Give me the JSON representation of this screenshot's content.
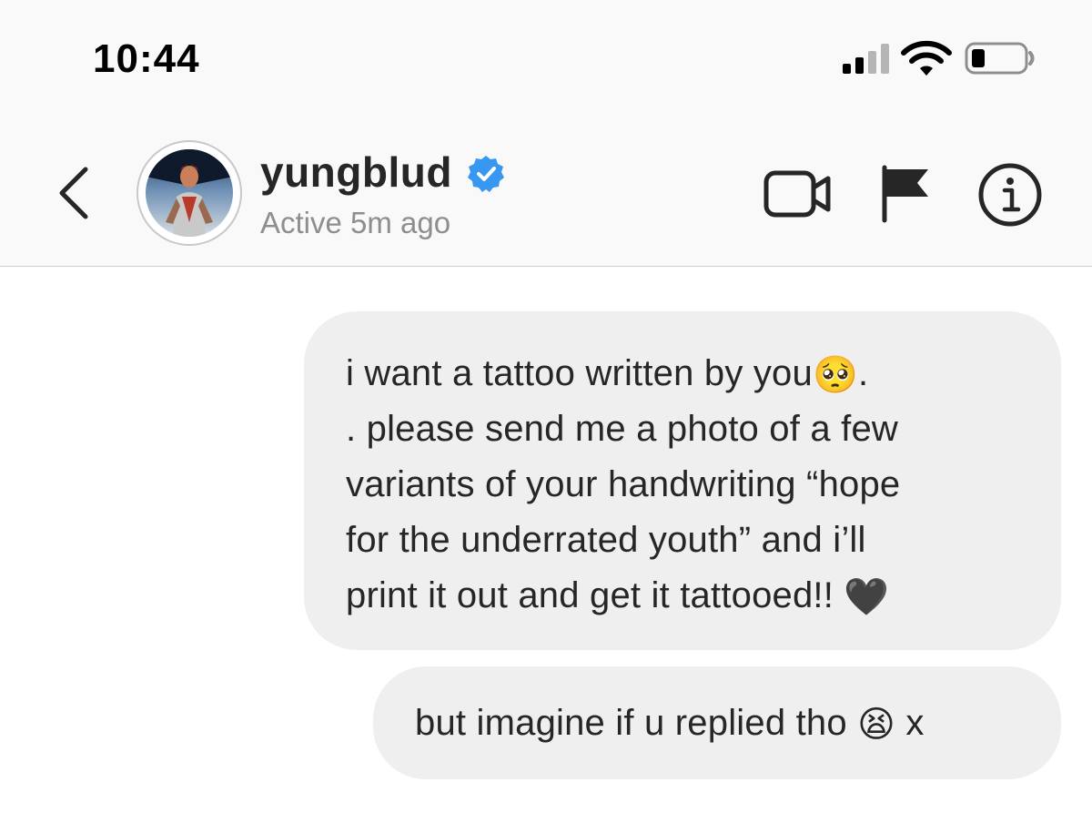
{
  "status_bar": {
    "time": "10:44",
    "signal_icon": "cellular-signal-icon",
    "wifi_icon": "wifi-icon",
    "battery_icon": "battery-icon"
  },
  "header": {
    "back_icon": "chevron-left-icon",
    "username": "yungblud",
    "verified_icon": "verified-badge-icon",
    "status": "Active 5m ago",
    "video_icon": "video-camera-icon",
    "flag_icon": "flag-icon",
    "info_icon": "info-icon"
  },
  "messages": [
    {
      "lines": [
        {
          "text": "i want a tattoo written by you",
          "emoji": "🥺",
          "trailing": "."
        },
        {
          "text": ". please send me a photo of a few"
        },
        {
          "text": "variants of your handwriting “hope"
        },
        {
          "text": "for the underrated youth” and i’ll"
        },
        {
          "text": "print it out and get it tattooed!! ",
          "emoji": "🖤"
        }
      ]
    },
    {
      "lines": [
        {
          "text": "but imagine if u replied tho ",
          "emoji": "😫",
          "trailing": " x"
        }
      ]
    }
  ],
  "colors": {
    "header_bg": "#f9f9f9",
    "bubble_bg": "#efefef",
    "verified_blue": "#3897f0",
    "secondary_text": "#8e8e8e"
  }
}
